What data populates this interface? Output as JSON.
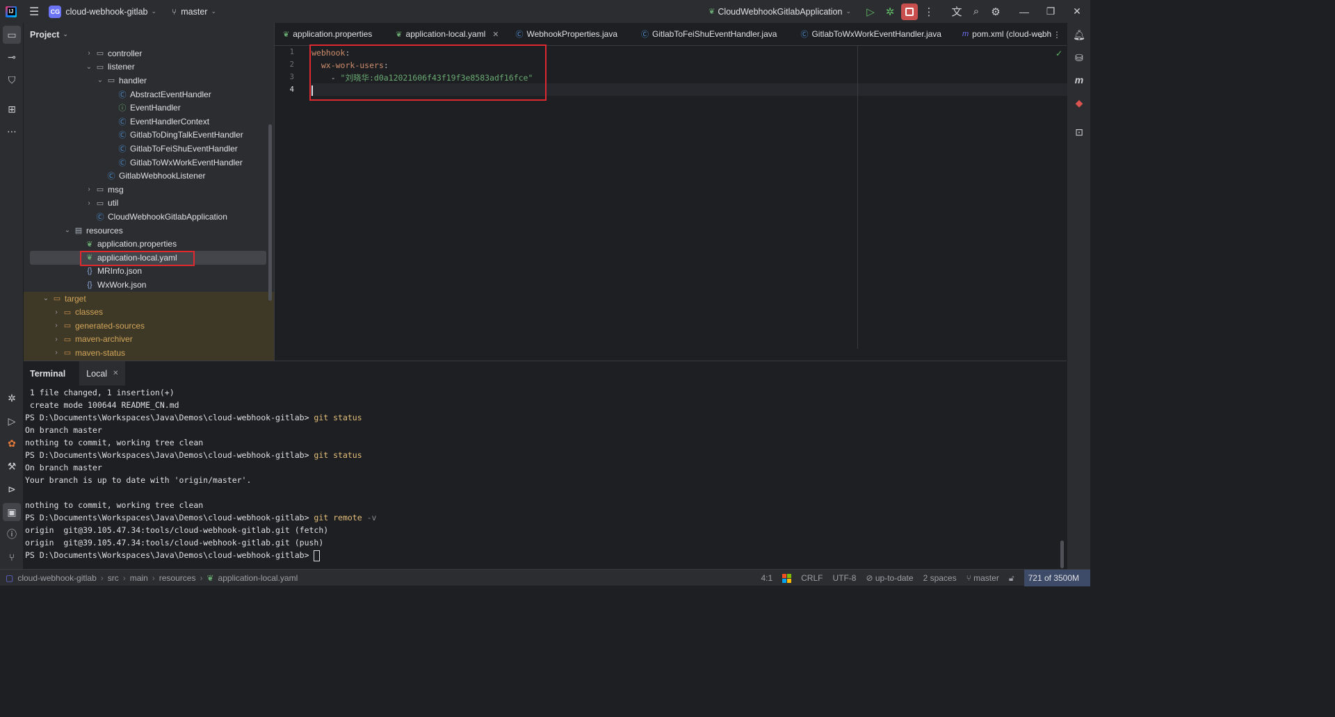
{
  "titlebar": {
    "project_badge": "CG",
    "project_name": "cloud-webhook-gitlab",
    "branch": "master",
    "run_config": "CloudWebhookGitlabApplication"
  },
  "project_panel": {
    "title": "Project",
    "tree": [
      {
        "label": "controller",
        "type": "folder",
        "expanded": false
      },
      {
        "label": "listener",
        "type": "folder",
        "expanded": true
      },
      {
        "label": "handler",
        "type": "folder",
        "expanded": true
      },
      {
        "label": "AbstractEventHandler",
        "type": "class"
      },
      {
        "label": "EventHandler",
        "type": "interface"
      },
      {
        "label": "EventHandlerContext",
        "type": "class"
      },
      {
        "label": "GitlabToDingTalkEventHandler",
        "type": "class"
      },
      {
        "label": "GitlabToFeiShuEventHandler",
        "type": "class"
      },
      {
        "label": "GitlabToWxWorkEventHandler",
        "type": "class"
      },
      {
        "label": "GitlabWebhookListener",
        "type": "class"
      },
      {
        "label": "msg",
        "type": "folder",
        "expanded": false
      },
      {
        "label": "util",
        "type": "folder",
        "expanded": false
      },
      {
        "label": "CloudWebhookGitlabApplication",
        "type": "class"
      },
      {
        "label": "resources",
        "type": "folder",
        "expanded": true
      },
      {
        "label": "application.properties",
        "type": "yaml"
      },
      {
        "label": "application-local.yaml",
        "type": "yaml"
      },
      {
        "label": "MRInfo.json",
        "type": "json"
      },
      {
        "label": "WxWork.json",
        "type": "json"
      },
      {
        "label": "target",
        "type": "excluded-folder",
        "expanded": true
      },
      {
        "label": "classes",
        "type": "excluded-folder",
        "expanded": false
      },
      {
        "label": "generated-sources",
        "type": "excluded-folder",
        "expanded": false
      },
      {
        "label": "maven-archiver",
        "type": "excluded-folder",
        "expanded": false
      },
      {
        "label": "maven-status",
        "type": "excluded-folder",
        "expanded": false
      }
    ]
  },
  "editor": {
    "tabs": [
      {
        "label": "application.properties"
      },
      {
        "label": "application-local.yaml",
        "active": true
      },
      {
        "label": "WebhookProperties.java"
      },
      {
        "label": "GitlabToFeiShuEventHandler.java"
      },
      {
        "label": "GitlabToWxWorkEventHandler.java"
      },
      {
        "label": "pom.xml (cloud-webhc"
      }
    ],
    "line_numbers": [
      "1",
      "2",
      "3",
      "4"
    ],
    "code": {
      "l1_key": "webhook",
      "l1_colon": ":",
      "l2_indent": "  ",
      "l2_key": "wx-work-users",
      "l2_colon": ":",
      "l3_prefix": "    - ",
      "l3_value": "\"刘晓华:d0a12021606f43f19f3e8583adf16fce\""
    }
  },
  "terminal": {
    "title": "Terminal",
    "tab": "Local",
    "lines": [
      {
        "text": " 1 file changed, 1 insertion(+)"
      },
      {
        "text": " create mode 100644 README_CN.md"
      },
      {
        "prompt": "PS D:\\Documents\\Workspaces\\Java\\Demos\\cloud-webhook-gitlab> ",
        "cmd": "git status",
        "flag": ""
      },
      {
        "text": "On branch master"
      },
      {
        "text": "nothing to commit, working tree clean"
      },
      {
        "prompt": "PS D:\\Documents\\Workspaces\\Java\\Demos\\cloud-webhook-gitlab> ",
        "cmd": "git status",
        "flag": ""
      },
      {
        "text": "On branch master"
      },
      {
        "text": "Your branch is up to date with 'origin/master'."
      },
      {
        "text": ""
      },
      {
        "text": "nothing to commit, working tree clean"
      },
      {
        "prompt": "PS D:\\Documents\\Workspaces\\Java\\Demos\\cloud-webhook-gitlab> ",
        "cmd": "git remote ",
        "flag": "-v"
      },
      {
        "text": "origin  git@39.105.47.34:tools/cloud-webhook-gitlab.git (fetch)"
      },
      {
        "text": "origin  git@39.105.47.34:tools/cloud-webhook-gitlab.git (push)"
      },
      {
        "prompt": "PS D:\\Documents\\Workspaces\\Java\\Demos\\cloud-webhook-gitlab> ",
        "cmd": "",
        "flag": "",
        "cursor": true
      }
    ]
  },
  "statusbar": {
    "breadcrumb": [
      "cloud-webhook-gitlab",
      "src",
      "main",
      "resources",
      "application-local.yaml"
    ],
    "position": "4:1",
    "line_sep": "CRLF",
    "encoding": "UTF-8",
    "vcs": "up-to-date",
    "indent": "2 spaces",
    "branch": "master",
    "memory": "721 of 3500M"
  },
  "colors": {
    "accent": "#6b73f7",
    "highlight_box": "#e0292e",
    "yaml_key": "#cf8e6d",
    "string": "#6aab73"
  }
}
